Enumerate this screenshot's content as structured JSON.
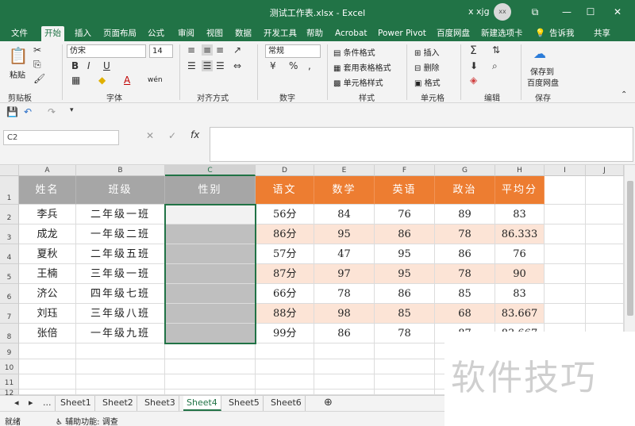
{
  "window": {
    "title": "测试工作表.xlsx - Excel",
    "user": "x xjg",
    "avatar": "xx",
    "minimize": "—",
    "maximize": "☐",
    "close": "✕",
    "ribbon_display": "⧉"
  },
  "tabs": [
    "文件",
    "开始",
    "插入",
    "页面布局",
    "公式",
    "审阅",
    "视图",
    "数据",
    "开发工具",
    "帮助",
    "Acrobat",
    "Power Pivot",
    "百度网盘",
    "新建选项卡",
    "告诉我",
    "共享"
  ],
  "ribbon": {
    "paste": "粘贴",
    "clipboard": "剪贴板",
    "font_name": "仿宋",
    "font_size": "14",
    "bold": "B",
    "italic": "I",
    "underline": "U",
    "font_color_glyph": "A",
    "wen": "wén",
    "font_group": "字体",
    "align_group": "对齐方式",
    "number_format": "常规",
    "currency": "¥",
    "percent": "%",
    "comma": ",",
    "number_group": "数字",
    "conditional": "条件格式",
    "table_format": "套用表格格式",
    "cell_style": "单元格样式",
    "style_group": "样式",
    "insert": "插入",
    "delete": "删除",
    "format": "格式",
    "cells_group": "单元格",
    "sigma": "Σ",
    "edit_group": "编辑",
    "save_to": "保存到",
    "baidu_pan": "百度网盘",
    "save_group": "保存"
  },
  "formula_bar": {
    "name_box": "C2",
    "cancel": "✕",
    "enter": "✓",
    "fx": "fx",
    "value": ""
  },
  "colors": {
    "excel_green": "#217346",
    "header_gray": "#a6a6a6",
    "selected_gray": "#bfbfbf",
    "orange_header": "#ed7d31",
    "orange_light": "#fce4d6"
  },
  "grid": {
    "columns": [
      "A",
      "B",
      "C",
      "D",
      "E",
      "F",
      "G",
      "H",
      "I",
      "J"
    ],
    "rows": [
      "1",
      "2",
      "3",
      "4",
      "5",
      "6",
      "7",
      "8",
      "9",
      "10",
      "11",
      "12"
    ],
    "headers": [
      "姓名",
      "班级",
      "性别",
      "语文",
      "数学",
      "英语",
      "政治",
      "平均分"
    ],
    "data": [
      [
        "李兵",
        "二年级一班",
        "",
        "56分",
        "84",
        "76",
        "89",
        "83"
      ],
      [
        "成龙",
        "一年级二班",
        "",
        "86分",
        "95",
        "86",
        "78",
        "86.333"
      ],
      [
        "夏秋",
        "二年级五班",
        "",
        "57分",
        "47",
        "95",
        "86",
        "76"
      ],
      [
        "王楠",
        "三年级一班",
        "",
        "87分",
        "97",
        "95",
        "78",
        "90"
      ],
      [
        "济公",
        "四年级七班",
        "",
        "66分",
        "78",
        "86",
        "85",
        "83"
      ],
      [
        "刘珏",
        "三年级八班",
        "",
        "88分",
        "98",
        "85",
        "68",
        "83.667"
      ],
      [
        "张倍",
        "一年级九班",
        "",
        "99分",
        "86",
        "78",
        "87",
        "83.667"
      ]
    ]
  },
  "sheet_tabs": [
    "...",
    "Sheet1",
    "Sheet2",
    "Sheet3",
    "Sheet4",
    "Sheet5",
    "Sheet6",
    "⊕"
  ],
  "active_sheet": "Sheet4",
  "status": {
    "mode": "就绪",
    "accessibility": "辅助功能: 调查"
  },
  "watermark": "软件技巧"
}
